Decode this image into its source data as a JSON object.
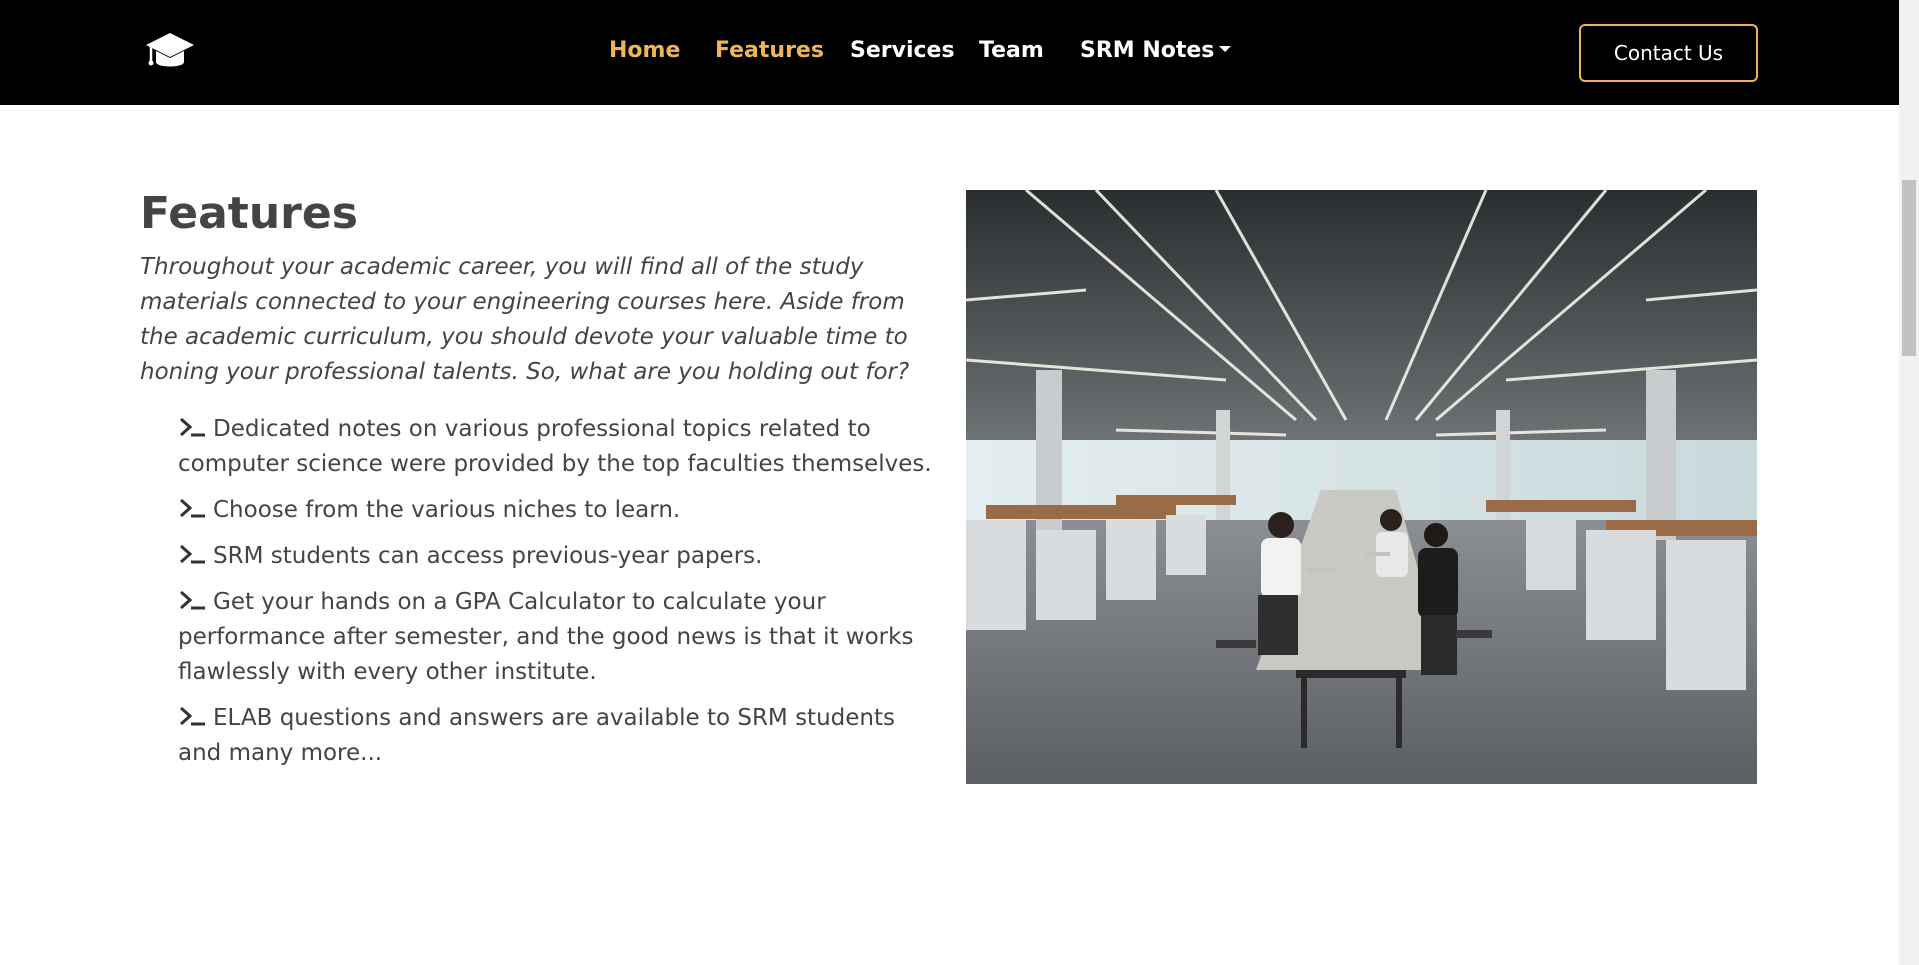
{
  "header": {
    "nav": [
      {
        "label": "Home",
        "active": true
      },
      {
        "label": "Features",
        "active": true
      },
      {
        "label": "Services",
        "active": false
      },
      {
        "label": "Team",
        "active": false
      },
      {
        "label": "SRM Notes",
        "active": false,
        "dropdown": true
      }
    ],
    "contact_label": "Contact Us"
  },
  "features": {
    "title": "Features",
    "intro": "Throughout your academic career, you will find all of the study materials connected to your engineering courses here. Aside from the academic curriculum, you should devote your valuable time to honing your professional talents. So, what are you holding out for?",
    "items": [
      "Dedicated notes on various professional topics related to computer science were provided by the top faculties themselves.",
      "Choose from the various niches to learn.",
      "SRM students can access previous-year papers.",
      "Get your hands on a GPA Calculator to calculate your performance after semester, and the good news is that it works flawlessly with every other institute.",
      "ELAB questions and answers are available to SRM students and many more..."
    ],
    "image": {
      "icon": "office-photo"
    }
  },
  "colors": {
    "nav_background": "#000000",
    "accent": "#f0b458",
    "text": "#444444"
  }
}
